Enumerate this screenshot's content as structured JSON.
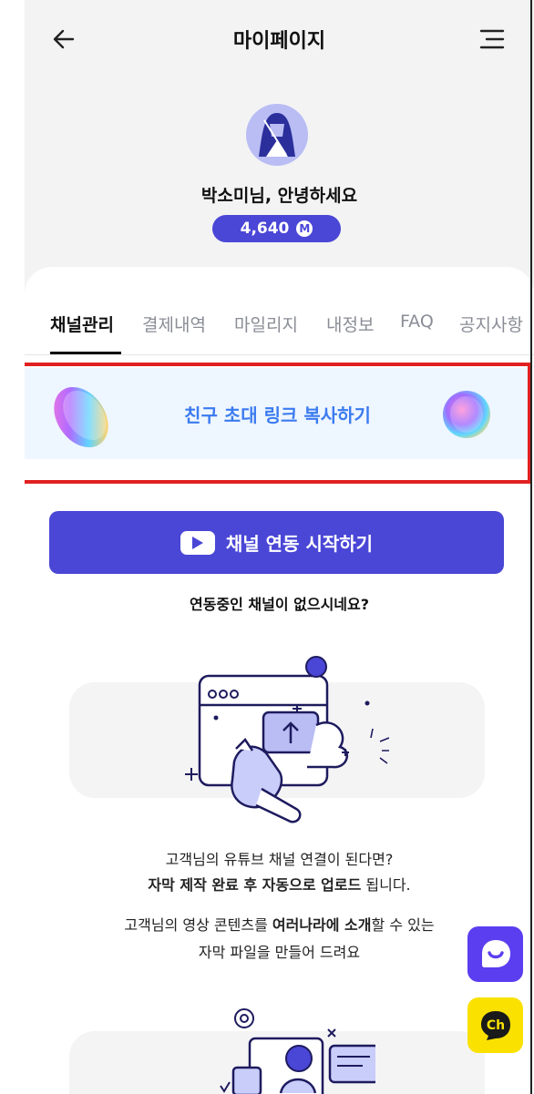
{
  "header": {
    "title": "마이페이지",
    "back_icon": "arrow-left-icon",
    "menu_icon": "hamburger-menu-icon"
  },
  "profile": {
    "greeting": "박소미님, 안녕하세요",
    "points": "4,640",
    "points_badge": "M"
  },
  "tabs": [
    {
      "label": "채널관리",
      "active": true
    },
    {
      "label": "결제내역",
      "active": false
    },
    {
      "label": "마일리지",
      "active": false
    },
    {
      "label": "내정보",
      "active": false
    },
    {
      "label": "FAQ",
      "active": false
    },
    {
      "label": "공지사항",
      "active": false
    }
  ],
  "invite": {
    "label": "친구 초대 링크 복사하기"
  },
  "connect": {
    "button_label": "채널 연동 시작하기",
    "icon": "youtube-icon",
    "empty_message": "연동중인 채널이 없으시네요?"
  },
  "description": {
    "line1": "고객님의 유튜브 채널 연결이 된다면?",
    "line2_bold": "자막 제작 완료 후 자동으로 업로드",
    "line2_rest": " 됩니다.",
    "line3_a": "고객님의 영상 콘텐츠를 ",
    "line3_bold": "여러나라에 소개",
    "line3_b": "할 수 있는",
    "line4": "자막 파일을 만들어 드려요"
  },
  "fabs": {
    "chat_icon": "chat-bubble-icon",
    "kakao_label": "Ch"
  },
  "colors": {
    "primary": "#4a46d6",
    "invite_text": "#3b7bf0",
    "invite_bg": "#eef6ff",
    "highlight_border": "#e02020",
    "kakao": "#fae100"
  }
}
